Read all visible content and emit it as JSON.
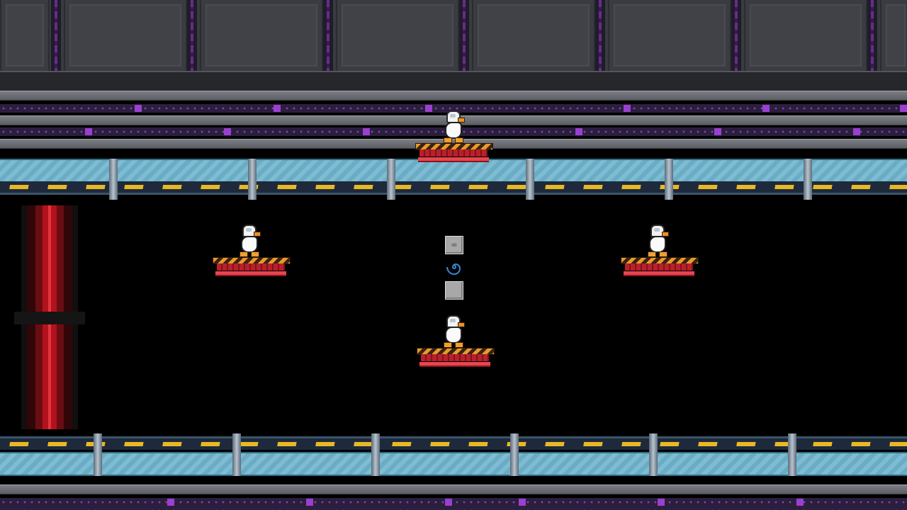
{
  "scene": {
    "colors": {
      "energy": "#e23440",
      "hazard_stripe": "#e9b824",
      "glass": "#7dbcd2",
      "rail_accent": "#8a3bc0",
      "platform_red": "#b8202c"
    }
  },
  "players": [
    {
      "id": "duck-top",
      "icon": "space-helmet-duck"
    },
    {
      "id": "duck-left",
      "icon": "space-helmet-duck"
    },
    {
      "id": "duck-right",
      "icon": "space-helmet-duck"
    },
    {
      "id": "duck-center",
      "icon": "space-helmet-duck"
    }
  ],
  "items": [
    {
      "name": "weapon-crate",
      "icon": "goggles-glyph",
      "glyph": "∞"
    },
    {
      "name": "item-spawner",
      "icon": "blue-swirl-icon"
    },
    {
      "name": "empty-crate",
      "icon": "grey-box-icon",
      "glyph": ""
    }
  ]
}
